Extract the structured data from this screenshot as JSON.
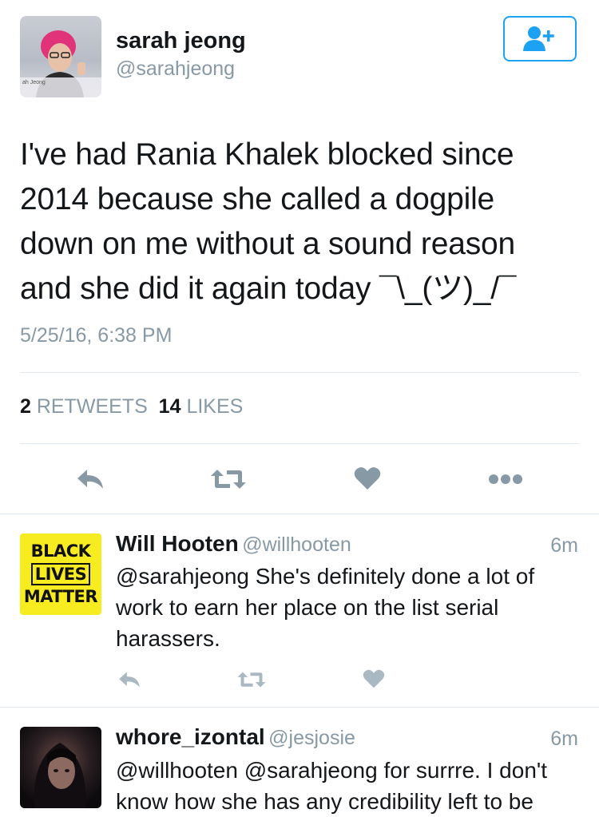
{
  "main_tweet": {
    "author_name": "sarah jeong",
    "author_handle": "@sarahjeong",
    "avatar_caption": "ah Jeong",
    "text": "I've had Rania Khalek blocked since\n2014 because she called a dogpile\ndown on me without a sound reason\nand she did it again today ¯\\_(ツ)_/¯",
    "timestamp": "5/25/16, 6:38 PM",
    "retweets_count": "2",
    "retweets_label": "RETWEETS",
    "likes_count": "14",
    "likes_label": "LIKES",
    "icons": {
      "follow": "add-user-icon",
      "reply": "reply-icon",
      "retweet": "retweet-icon",
      "like": "heart-icon",
      "more": "more-icon"
    }
  },
  "replies": [
    {
      "author_name": "Will Hooten",
      "author_handle": "@willhooten",
      "time": "6m",
      "avatar_text": [
        "BLACK",
        "LIVES",
        "MATTER"
      ],
      "text": "@sarahjeong She's definitely done a lot of work to earn her place on the list serial harassers."
    },
    {
      "author_name": "whore_izontal",
      "author_handle": "@jesjosie",
      "time": "6m",
      "text": "@willhooten @sarahjeong for surrre. I don't know how she has any credibility left to be"
    }
  ],
  "colors": {
    "accent": "#1da1f2",
    "secondary_text": "#8899a6",
    "icon_gray": "#8899a6",
    "divider": "#e1e8ed",
    "blm_yellow": "#f6ec1f"
  }
}
